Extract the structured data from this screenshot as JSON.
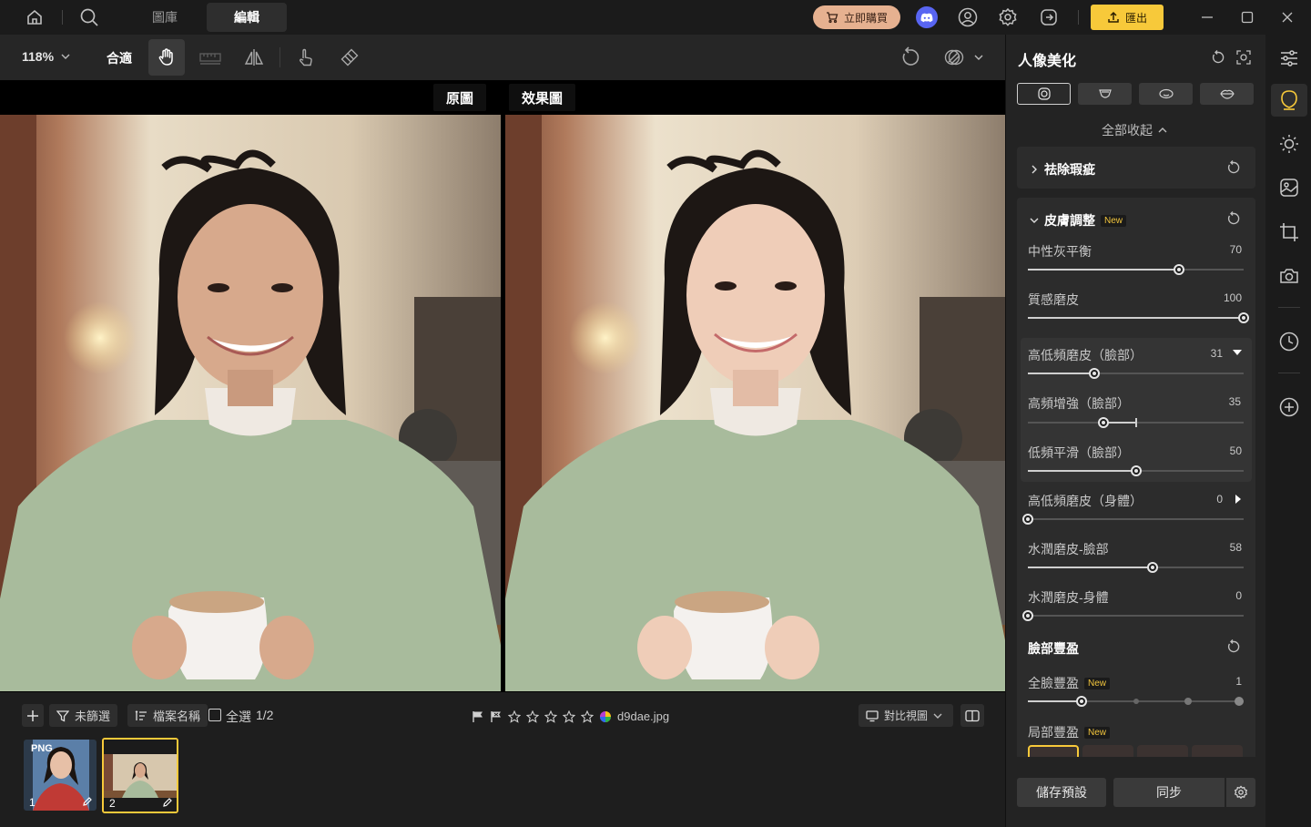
{
  "topbar": {
    "tabs": [
      {
        "label": "圖庫"
      },
      {
        "label": "編輯"
      }
    ],
    "buy_label": "立即購買",
    "export_label": "匯出"
  },
  "toolbar": {
    "zoom": "118%",
    "fit_label": "合適"
  },
  "canvas": {
    "original_label": "原圖",
    "result_label": "效果圖"
  },
  "filmstrip": {
    "filter_label": "未篩選",
    "sort_label": "檔案名稱",
    "select_all_label": "全選",
    "selection_count": "1/2",
    "filename": "d9dae.jpg",
    "compare_view_label": "對比視圖",
    "thumbs": [
      {
        "number": "1",
        "format": "PNG"
      },
      {
        "number": "2"
      }
    ]
  },
  "panel": {
    "title": "人像美化",
    "collapse_all": "全部收起",
    "new_badge": "New",
    "sections": {
      "blemish": "祛除瑕疵",
      "skin": "皮膚調整",
      "face_volume": "臉部豐盈"
    },
    "sliders": [
      {
        "label": "中性灰平衡",
        "value": 70
      },
      {
        "label": "質感磨皮",
        "value": 100
      },
      {
        "label": "高低頻磨皮（臉部）",
        "value": 31
      },
      {
        "label": "高頻增強（臉部）",
        "value": 35
      },
      {
        "label": "低頻平滑（臉部）",
        "value": 50
      },
      {
        "label": "高低頻磨皮（身體）",
        "value": 0
      },
      {
        "label": "水潤磨皮-臉部",
        "value": 58
      },
      {
        "label": "水潤磨皮-身體",
        "value": 0
      },
      {
        "label": "全臉豐盈",
        "value": 1
      },
      {
        "label": "局部豐盈"
      }
    ],
    "save_preset": "儲存預設",
    "sync": "同步"
  },
  "colors": {
    "accent": "#f7c93a",
    "buy_button": "#e6b190",
    "discord": "#5865f2"
  }
}
